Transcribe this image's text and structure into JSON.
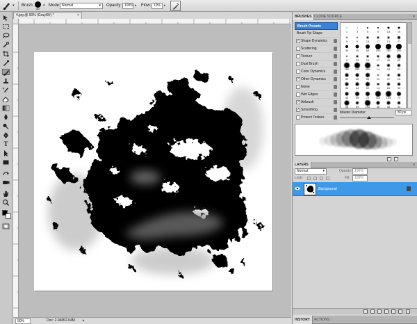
{
  "options_bar": {
    "brush_label": "Brush:",
    "brush_size": "80",
    "mode_label": "Mode:",
    "mode_value": "Normal",
    "opacity_label": "Opacity:",
    "opacity_value": "100%",
    "flow_label": "Flow:",
    "flow_value": "10%"
  },
  "document": {
    "tab_title": "4.jpg @ 50% (Gray/8#) *",
    "zoom": "50%",
    "doc_size": "Doc: 2.04M/2.04M"
  },
  "brushes_panel": {
    "tabs": [
      "BRUSHES",
      "CLONE SOURCE"
    ],
    "items": [
      {
        "label": "Brush Presets",
        "type": "header"
      },
      {
        "label": "Brush Tip Shape",
        "type": "plain"
      },
      {
        "label": "Shape Dynamics",
        "checked": true,
        "type": "option"
      },
      {
        "label": "Scattering",
        "checked": false,
        "type": "option"
      },
      {
        "label": "Texture",
        "checked": false,
        "type": "option"
      },
      {
        "label": "Dual Brush",
        "checked": false,
        "type": "option"
      },
      {
        "label": "Color Dynamics",
        "checked": false,
        "type": "option"
      },
      {
        "label": "Other Dynamics",
        "checked": true,
        "type": "option"
      },
      {
        "label": "Noise",
        "checked": false,
        "type": "option"
      },
      {
        "label": "Wet Edges",
        "checked": false,
        "type": "option"
      },
      {
        "label": "Airbrush",
        "checked": true,
        "type": "option"
      },
      {
        "label": "Smoothing",
        "checked": true,
        "type": "option"
      },
      {
        "label": "Protect Texture",
        "checked": false,
        "type": "option"
      }
    ],
    "tip_numbers": [
      "1",
      "3",
      "5",
      "9",
      "13",
      "19",
      "5",
      "9",
      "13",
      "17",
      "21",
      "27",
      "35",
      "45",
      "65",
      "100",
      "200",
      "300",
      "9",
      "13",
      "19",
      "17",
      "45",
      "65",
      "100",
      "200",
      "300",
      "14",
      "24",
      "27",
      "39",
      "46",
      "59",
      "11",
      "17",
      "23",
      "36",
      "44",
      "60",
      "14",
      "26",
      "33",
      "42",
      "55",
      "70",
      "112",
      "134",
      "74",
      "95",
      "29",
      "192",
      "36",
      "36",
      "33"
    ],
    "master_diameter_label": "Master Diameter",
    "master_diameter_value": "80 px"
  },
  "layers_panel": {
    "tabs": [
      "LAYERS"
    ],
    "blend_mode": "Normal",
    "opacity_label": "Opacity:",
    "opacity_value": "100%",
    "lock_label": "Lock:",
    "fill_label": "Fill:",
    "fill_value": "100%",
    "layer_name": "Background"
  },
  "history_panel": {
    "tabs": [
      "HISTORY",
      "ACTIONS"
    ]
  }
}
